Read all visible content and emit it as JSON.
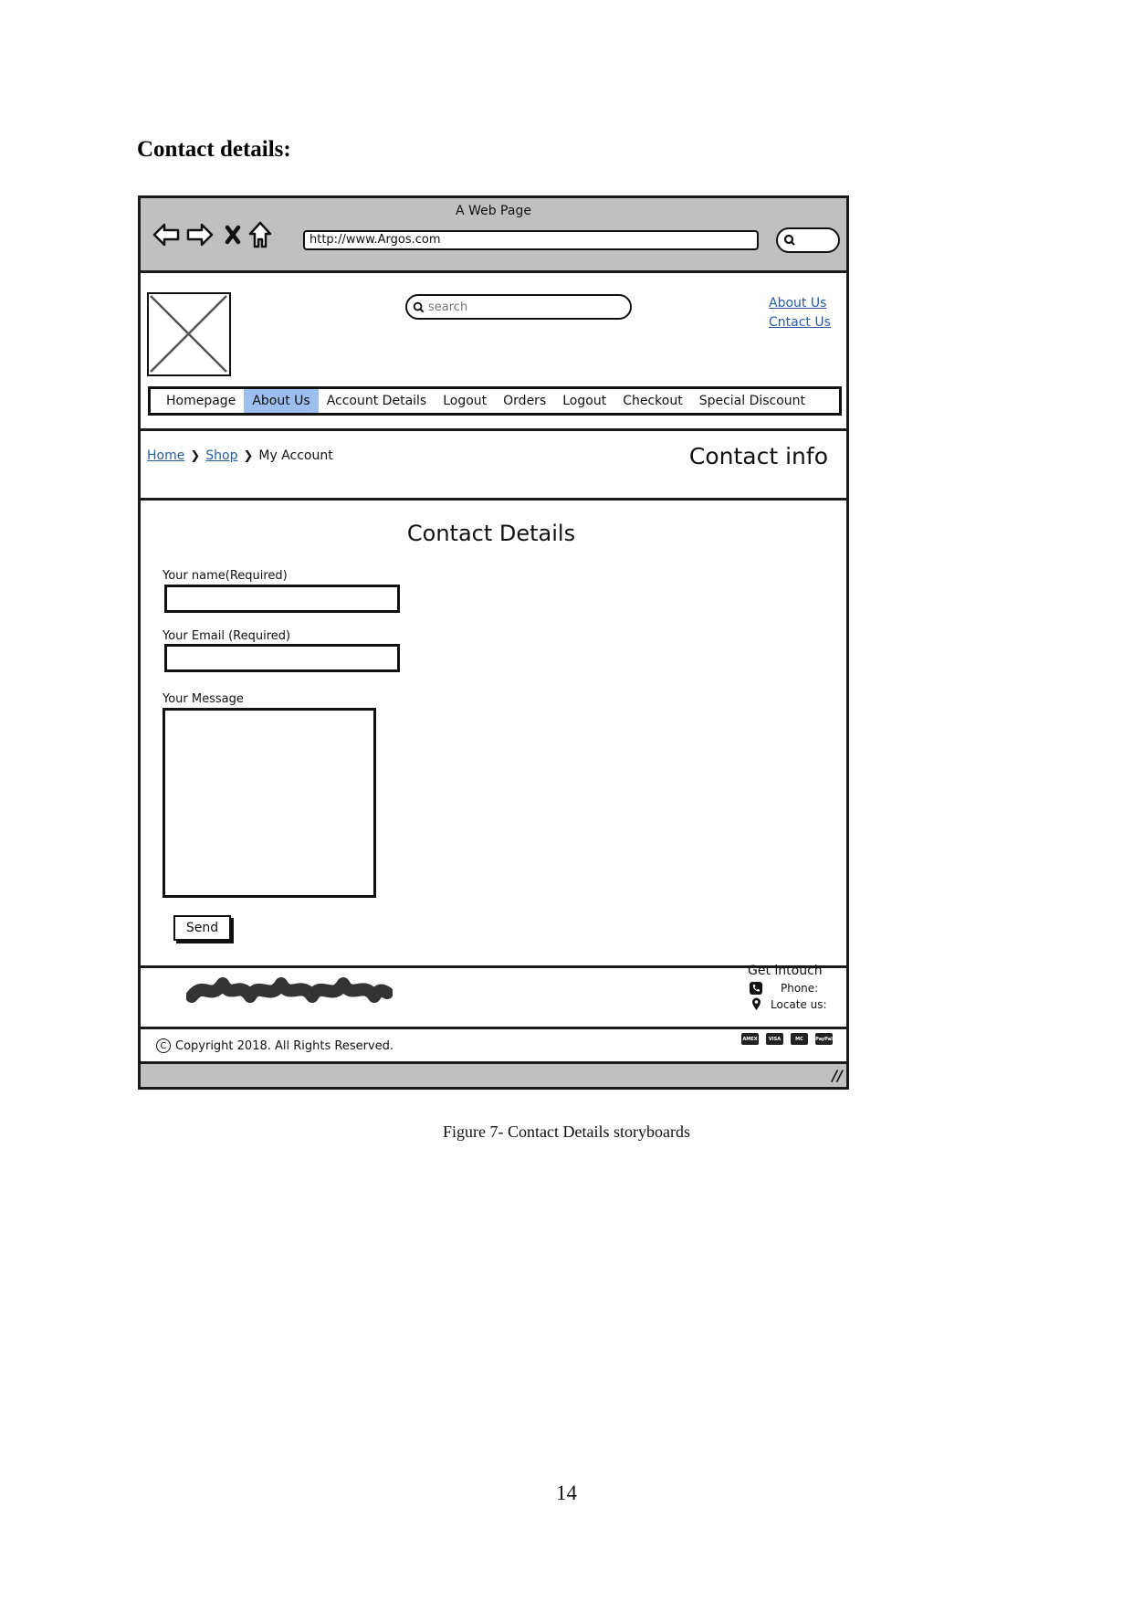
{
  "document": {
    "heading": "Contact details:",
    "caption": "Figure 7- Contact Details storyboards",
    "page_number": "14"
  },
  "mockup": {
    "window_title": "A Web Page",
    "browser_icons": [
      "back-arrow-icon",
      "forward-arrow-icon",
      "stop-icon",
      "home-icon"
    ],
    "url": "http://www.Argos.com",
    "header": {
      "search_placeholder": "search",
      "top_links": [
        "About Us",
        "Cntact Us"
      ]
    },
    "nav": {
      "items": [
        "Homepage",
        "About Us",
        "Account Details",
        "Logout",
        "Orders",
        "Logout",
        "Checkout",
        "Special Discount"
      ],
      "active_index": 1
    },
    "breadcrumb": {
      "items": [
        "Home",
        "Shop",
        "My Account"
      ]
    },
    "section_title": "Contact info",
    "form": {
      "title": "Contact Details",
      "name_label": "Your name(Required)",
      "name_value": "",
      "email_label": "Your Email (Required)",
      "email_value": "",
      "message_label": "Your Message",
      "message_value": "",
      "send_label": "Send"
    },
    "footer": {
      "get_in_touch": "Get intouch",
      "phone_label": "Phone:",
      "locate_label": "Locate us:",
      "copyright": "Copyright 2018. All Rights Reserved.",
      "payment_icons": [
        {
          "name": "amex",
          "label": "AMEX"
        },
        {
          "name": "visa",
          "label": "VISA"
        },
        {
          "name": "mastercard",
          "label": "MC"
        },
        {
          "name": "paypal",
          "label": "PayPal"
        }
      ]
    },
    "colors": {
      "chrome_gray": "#c0c0c0",
      "active_nav": "#9dbff0",
      "link": "#2a5aa0",
      "border": "#1a1a1a"
    }
  }
}
